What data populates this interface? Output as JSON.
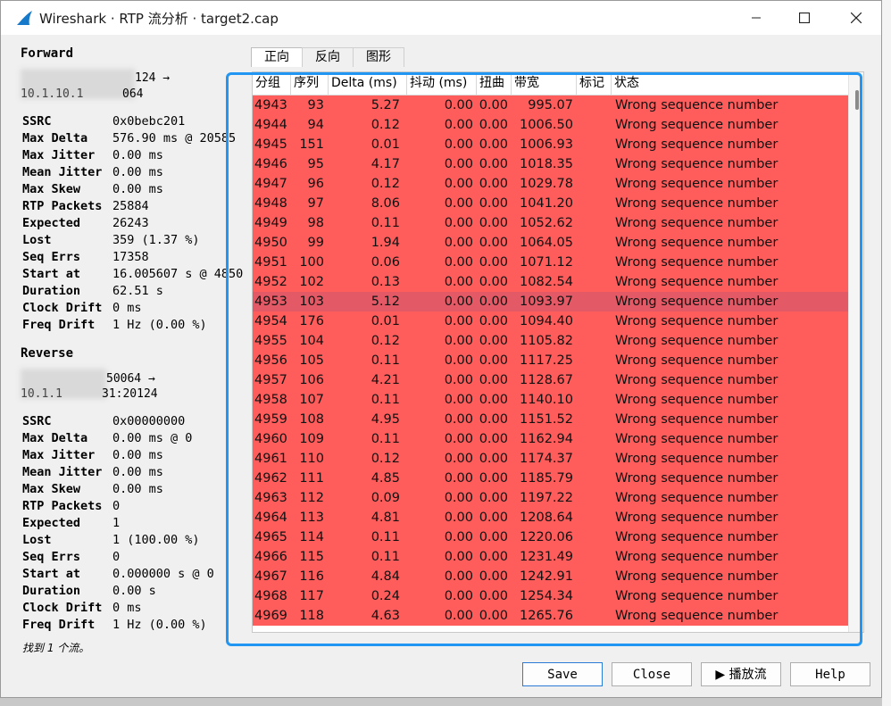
{
  "window": {
    "title": "Wireshark · RTP 流分析 · target2.cap"
  },
  "forward": {
    "title": "Forward",
    "addr_line1": "124 →",
    "addr_line2": "10.1.10.1",
    "addr_line2_tail": "064",
    "stats": [
      {
        "k": "SSRC",
        "v": "0x0bebc201"
      },
      {
        "k": "Max Delta",
        "v": "576.90 ms @ 20585"
      },
      {
        "k": "Max Jitter",
        "v": "0.00 ms"
      },
      {
        "k": "Mean Jitter",
        "v": "0.00 ms"
      },
      {
        "k": "Max Skew",
        "v": "0.00 ms"
      },
      {
        "k": "RTP Packets",
        "v": "25884"
      },
      {
        "k": "Expected",
        "v": "26243"
      },
      {
        "k": "Lost",
        "v": "359 (1.37 %)"
      },
      {
        "k": "Seq Errs",
        "v": "17358"
      },
      {
        "k": "Start at",
        "v": "16.005607 s @ 4850"
      },
      {
        "k": "Duration",
        "v": "62.51 s"
      },
      {
        "k": "Clock Drift",
        "v": "0 ms"
      },
      {
        "k": "Freq Drift",
        "v": "1 Hz (0.00 %)"
      }
    ]
  },
  "reverse": {
    "title": "Reverse",
    "addr_line1": "50064 →",
    "addr_line2": "10.1.1",
    "addr_line2_tail": "31:20124",
    "stats": [
      {
        "k": "SSRC",
        "v": "0x00000000"
      },
      {
        "k": "Max Delta",
        "v": "0.00 ms @ 0"
      },
      {
        "k": "Max Jitter",
        "v": "0.00 ms"
      },
      {
        "k": "Mean Jitter",
        "v": "0.00 ms"
      },
      {
        "k": "Max Skew",
        "v": "0.00 ms"
      },
      {
        "k": "RTP Packets",
        "v": "0"
      },
      {
        "k": "Expected",
        "v": "1"
      },
      {
        "k": "Lost",
        "v": "1 (100.00 %)"
      },
      {
        "k": "Seq Errs",
        "v": "0"
      },
      {
        "k": "Start at",
        "v": "0.000000 s @ 0"
      },
      {
        "k": "Duration",
        "v": "0.00 s"
      },
      {
        "k": "Clock Drift",
        "v": "0 ms"
      },
      {
        "k": "Freq Drift",
        "v": "1 Hz (0.00 %)"
      }
    ]
  },
  "found_text": "找到 1 个流。",
  "tabs": [
    "正向",
    "反向",
    "图形"
  ],
  "table": {
    "columns": [
      "分组",
      "序列",
      "Delta (ms)",
      "抖动 (ms)",
      "扭曲",
      "带宽",
      "标记",
      "状态"
    ],
    "rows": [
      [
        "4943",
        "93",
        "5.27",
        "0.00",
        "0.00",
        "995.07",
        "",
        "Wrong sequence number"
      ],
      [
        "4944",
        "94",
        "0.12",
        "0.00",
        "0.00",
        "1006.50",
        "",
        "Wrong sequence number"
      ],
      [
        "4945",
        "151",
        "0.01",
        "0.00",
        "0.00",
        "1006.93",
        "",
        "Wrong sequence number"
      ],
      [
        "4946",
        "95",
        "4.17",
        "0.00",
        "0.00",
        "1018.35",
        "",
        "Wrong sequence number"
      ],
      [
        "4947",
        "96",
        "0.12",
        "0.00",
        "0.00",
        "1029.78",
        "",
        "Wrong sequence number"
      ],
      [
        "4948",
        "97",
        "8.06",
        "0.00",
        "0.00",
        "1041.20",
        "",
        "Wrong sequence number"
      ],
      [
        "4949",
        "98",
        "0.11",
        "0.00",
        "0.00",
        "1052.62",
        "",
        "Wrong sequence number"
      ],
      [
        "4950",
        "99",
        "1.94",
        "0.00",
        "0.00",
        "1064.05",
        "",
        "Wrong sequence number"
      ],
      [
        "4951",
        "100",
        "0.06",
        "0.00",
        "0.00",
        "1071.12",
        "",
        "Wrong sequence number"
      ],
      [
        "4952",
        "102",
        "0.13",
        "0.00",
        "0.00",
        "1082.54",
        "",
        "Wrong sequence number"
      ],
      [
        "4953",
        "103",
        "5.12",
        "0.00",
        "0.00",
        "1093.97",
        "",
        "Wrong sequence number"
      ],
      [
        "4954",
        "176",
        "0.01",
        "0.00",
        "0.00",
        "1094.40",
        "",
        "Wrong sequence number"
      ],
      [
        "4955",
        "104",
        "0.12",
        "0.00",
        "0.00",
        "1105.82",
        "",
        "Wrong sequence number"
      ],
      [
        "4956",
        "105",
        "0.11",
        "0.00",
        "0.00",
        "1117.25",
        "",
        "Wrong sequence number"
      ],
      [
        "4957",
        "106",
        "4.21",
        "0.00",
        "0.00",
        "1128.67",
        "",
        "Wrong sequence number"
      ],
      [
        "4958",
        "107",
        "0.11",
        "0.00",
        "0.00",
        "1140.10",
        "",
        "Wrong sequence number"
      ],
      [
        "4959",
        "108",
        "4.95",
        "0.00",
        "0.00",
        "1151.52",
        "",
        "Wrong sequence number"
      ],
      [
        "4960",
        "109",
        "0.11",
        "0.00",
        "0.00",
        "1162.94",
        "",
        "Wrong sequence number"
      ],
      [
        "4961",
        "110",
        "0.12",
        "0.00",
        "0.00",
        "1174.37",
        "",
        "Wrong sequence number"
      ],
      [
        "4962",
        "111",
        "4.85",
        "0.00",
        "0.00",
        "1185.79",
        "",
        "Wrong sequence number"
      ],
      [
        "4963",
        "112",
        "0.09",
        "0.00",
        "0.00",
        "1197.22",
        "",
        "Wrong sequence number"
      ],
      [
        "4964",
        "113",
        "4.81",
        "0.00",
        "0.00",
        "1208.64",
        "",
        "Wrong sequence number"
      ],
      [
        "4965",
        "114",
        "0.11",
        "0.00",
        "0.00",
        "1220.06",
        "",
        "Wrong sequence number"
      ],
      [
        "4966",
        "115",
        "0.11",
        "0.00",
        "0.00",
        "1231.49",
        "",
        "Wrong sequence number"
      ],
      [
        "4967",
        "116",
        "4.84",
        "0.00",
        "0.00",
        "1242.91",
        "",
        "Wrong sequence number"
      ],
      [
        "4968",
        "117",
        "0.24",
        "0.00",
        "0.00",
        "1254.34",
        "",
        "Wrong sequence number"
      ],
      [
        "4969",
        "118",
        "4.63",
        "0.00",
        "0.00",
        "1265.76",
        "",
        "Wrong sequence number"
      ]
    ],
    "selected_packet": "4953",
    "row_color": "#ff5c5c",
    "selected_color": "#e35a66"
  },
  "buttons": {
    "save": "Save",
    "close": "Close",
    "play": "▶ 播放流",
    "help": "Help"
  },
  "accent_color": "#2196f3"
}
